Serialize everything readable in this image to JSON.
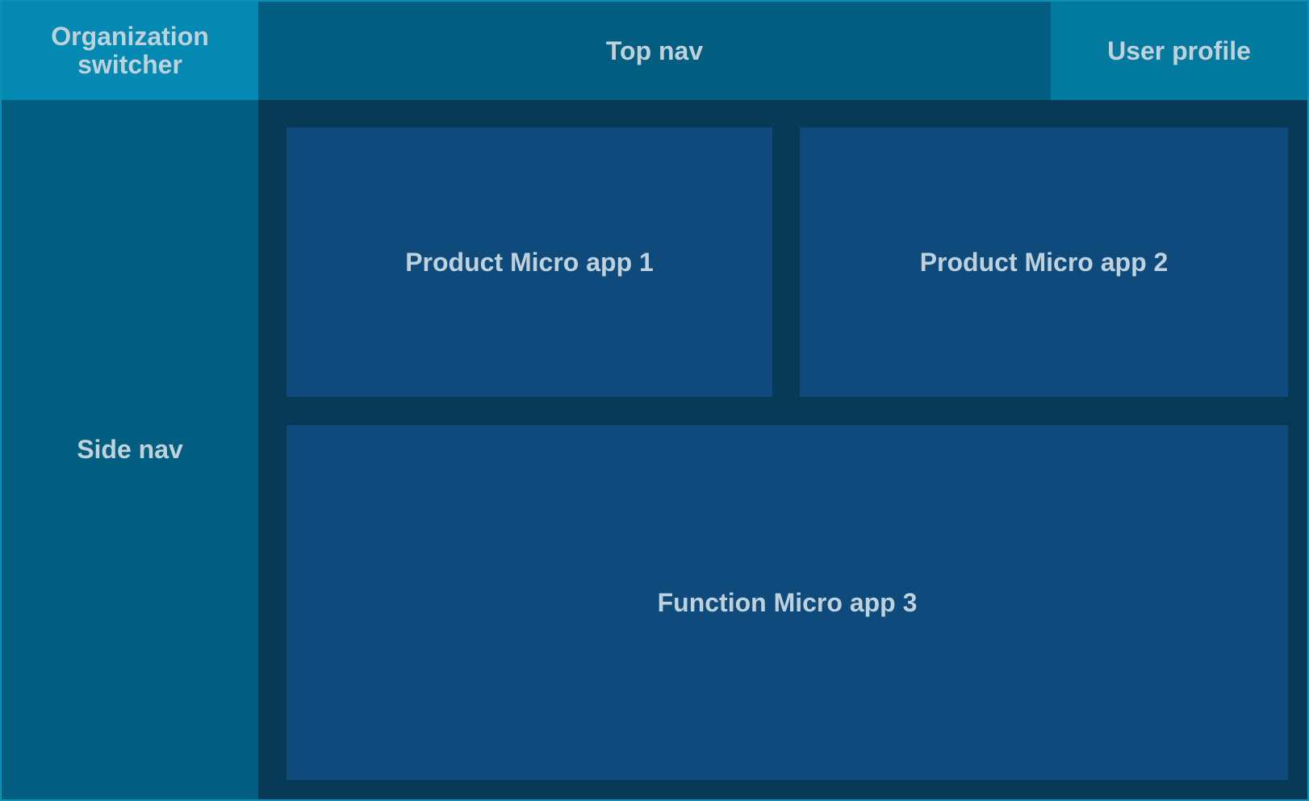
{
  "layout": {
    "org_switcher": {
      "line1": "Organization",
      "line2": "switcher"
    },
    "top_nav": {
      "label": "Top nav"
    },
    "user_profile": {
      "label": "User profile"
    },
    "side_nav": {
      "label": "Side nav"
    },
    "apps": [
      {
        "label": "Product Micro app 1"
      },
      {
        "label": "Product Micro app 2"
      },
      {
        "label": "Function Micro app 3"
      }
    ]
  },
  "colors": {
    "org_switcher_bg": "#0389b2",
    "top_nav_bg": "#025e80",
    "user_profile_bg": "#027a9f",
    "side_nav_bg": "#025e80",
    "content_bg": "#063a57",
    "app_bg": "#0f4a7d",
    "text": "#bfd2dc"
  }
}
